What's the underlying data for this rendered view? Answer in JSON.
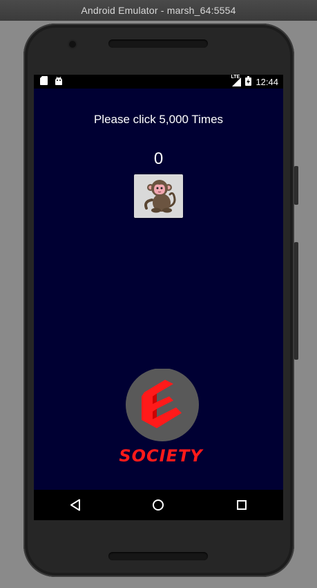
{
  "window": {
    "title": "Android Emulator - marsh_64:5554"
  },
  "status_bar": {
    "left_icons": [
      "sd-card-icon",
      "android-debug-icon"
    ],
    "network": "LTE",
    "time": "12:44"
  },
  "app": {
    "instruction": "Please click 5,000 Times",
    "counter": "0",
    "button_icon": "monkey-icon"
  },
  "logo": {
    "text": "SOCIETY",
    "colors": {
      "circle": "#595959",
      "accent": "#ff1a1a",
      "background": "#000033"
    }
  },
  "nav_bar": {
    "buttons": [
      "back-icon",
      "home-icon",
      "recents-icon"
    ]
  }
}
